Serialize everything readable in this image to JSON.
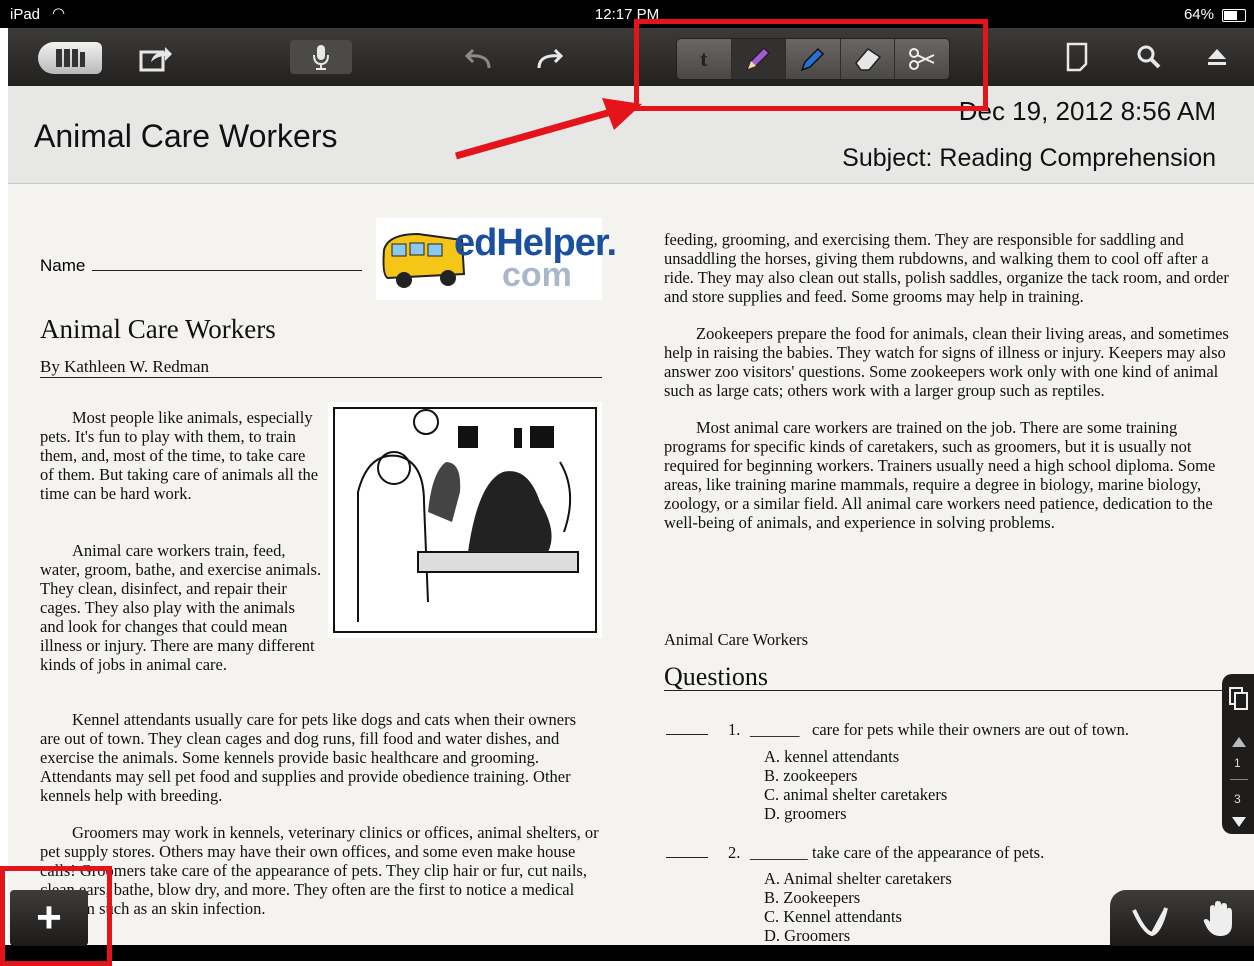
{
  "status_bar": {
    "device": "iPad",
    "time": "12:17 PM",
    "battery": "64%"
  },
  "toolbar": {
    "icons": [
      "library-icon",
      "share-icon",
      "microphone-icon",
      "undo-icon",
      "redo-icon",
      "text-tool-icon",
      "pencil-icon",
      "highlighter-icon",
      "eraser-icon",
      "scissors-icon",
      "page-icon",
      "search-icon",
      "eject-icon"
    ],
    "text_tool_label": "t"
  },
  "header": {
    "title": "Animal Care Workers",
    "date": "Dec 19, 2012 8:56 AM",
    "subject": "Subject: Reading Comprehension"
  },
  "worksheet": {
    "name_label": "Name",
    "logo_text": "edHelper.",
    "logo_sub": "com",
    "title": "Animal Care Workers",
    "author": "By Kathleen W. Redman",
    "left_paragraphs": [
      "Most people like animals, especially pets. It's fun to play with them, to train them, and, most of the time, to take care of them. But taking care of animals all the time can be hard work.",
      "Animal care workers train, feed, water, groom, bathe, and exercise animals. They clean, disinfect, and repair their cages. They also play with the animals and look for changes that could mean illness or injury. There are many different kinds of jobs in animal care.",
      "Kennel attendants usually care for pets like dogs and cats when their owners are out of town. They clean cages and dog runs, fill food and water dishes, and exercise the animals. Some kennels provide basic healthcare and grooming. Attendants may sell pet food and supplies and provide obedience training. Other kennels help with breeding.",
      "Groomers may work in kennels, veterinary clinics or offices, animal shelters, or pet supply stores. Others may have their own offices, and some even make house calls! Groomers take care of the appearance of pets. They clip hair or fur, cut nails, clean ears, bathe, blow dry, and more. They often are the first to notice a medical problem such as an skin infection."
    ],
    "right_paragraphs": [
      "feeding, grooming, and exercising them. They are responsible for saddling and unsaddling the horses, giving them rubdowns, and walking them to cool off after a ride. They may also clean out stalls, polish saddles, organize the tack room, and order and store supplies and feed. Some grooms may help in training.",
      "Zookeepers prepare the food for animals, clean their living areas, and sometimes help in raising the babies. They watch for signs of illness or injury. Keepers may also answer zoo visitors' questions. Some zookeepers work only with one kind of animal such as large cats; others work with a larger group such as reptiles.",
      "Most animal care workers are trained on the job. There are some training programs for specific kinds of caretakers, such as groomers, but it is usually not required for beginning workers. Trainers usually need a high school diploma. Some areas, like training marine mammals, require a degree in biology, marine biology, zoology, or a similar field. All animal care workers need patience, dedication to the well-being of animals, and experience in solving problems."
    ],
    "section_label": "Animal Care Workers",
    "questions_heading": "Questions",
    "questions": [
      {
        "number": "1.",
        "blank": "______",
        "text": "care for pets while their owners are out of town.",
        "options": [
          "A. kennel attendants",
          "B. zookeepers",
          "C. animal shelter caretakers",
          "D. groomers"
        ]
      },
      {
        "number": "2.",
        "blank": "_______",
        "text": "take care of the appearance of pets.",
        "options": [
          "A. Animal shelter caretakers",
          "B. Zookeepers",
          "C. Kennel attendants",
          "D. Groomers"
        ]
      }
    ]
  },
  "page_nav": {
    "current": "1",
    "total": "3"
  },
  "bottom": {
    "add_label": "+"
  },
  "colors": {
    "annotation_red": "#e5141b",
    "toolbar_bg": "#2e2c2a",
    "page_bg": "#f4f3ef"
  }
}
